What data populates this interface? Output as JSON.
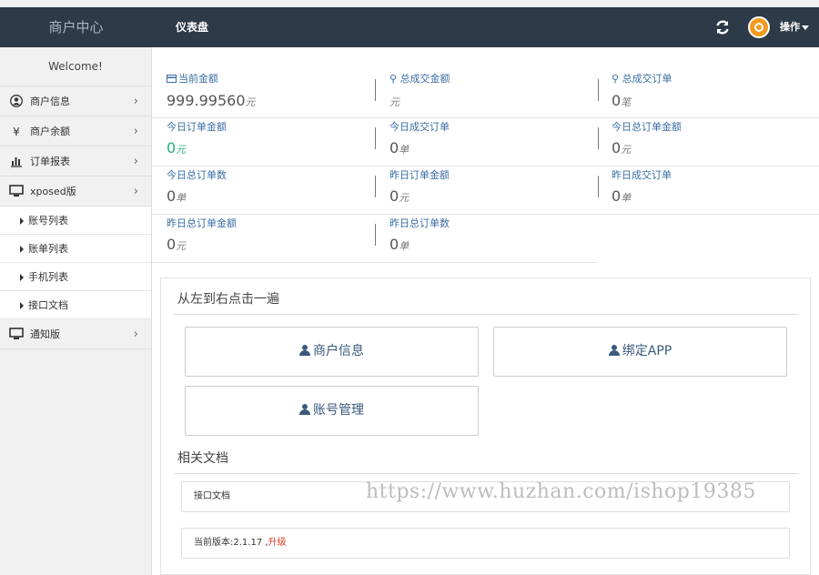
{
  "header": {
    "brand": "商户中心",
    "nav_dashboard": "仪表盘",
    "ops_label": "操作"
  },
  "sidebar": {
    "welcome": "Welcome!",
    "items": [
      {
        "label": "商户信息",
        "icon": "user-circle-icon"
      },
      {
        "label": "商户余额",
        "icon": "yen-icon"
      },
      {
        "label": "订单报表",
        "icon": "bar-chart-icon"
      },
      {
        "label": "xposed版",
        "icon": "monitor-icon"
      }
    ],
    "subitems": [
      "账号列表",
      "账单列表",
      "手机列表",
      "接口文档"
    ],
    "notify": {
      "label": "通知版",
      "icon": "monitor-icon"
    }
  },
  "stats": {
    "current_balance": {
      "label": "当前金额",
      "value": "999.99560",
      "unit": "元"
    },
    "total_amount": {
      "label": "总成交金额",
      "value": "",
      "unit": "元"
    },
    "total_orders": {
      "label": "总成交订单",
      "value": "0",
      "unit": "笔"
    },
    "today_amount": {
      "label": "今日订单金额",
      "value": "0",
      "unit": "元"
    },
    "today_success": {
      "label": "今日成交订单",
      "value": "0",
      "unit": "单"
    },
    "today_total_amount": {
      "label": "今日总订单金额",
      "value": "0",
      "unit": "元"
    },
    "today_total_count": {
      "label": "今日总订单数",
      "value": "0",
      "unit": "单"
    },
    "yesterday_amount": {
      "label": "昨日订单金额",
      "value": "0",
      "unit": "元"
    },
    "yesterday_success": {
      "label": "昨日成交订单",
      "value": "0",
      "unit": "单"
    },
    "yesterday_total_amount": {
      "label": "昨日总订单金额",
      "value": "0",
      "unit": "元"
    },
    "yesterday_total_count": {
      "label": "昨日总订单数",
      "value": "0",
      "unit": "单"
    }
  },
  "panel": {
    "title1": "从左到右点击一遍",
    "buttons": [
      "商户信息",
      "绑定APP",
      "账号管理"
    ],
    "title2": "相关文档",
    "doc_link": "接口文档",
    "version_prefix": "当前版本:2.1.17 ,",
    "upgrade": "升级"
  },
  "watermark": "https://www.huzhan.com/ishop19385",
  "colors": {
    "topbar": "#2d3a48",
    "accent_green": "#27b07b",
    "upgrade_red": "#d9362b"
  }
}
